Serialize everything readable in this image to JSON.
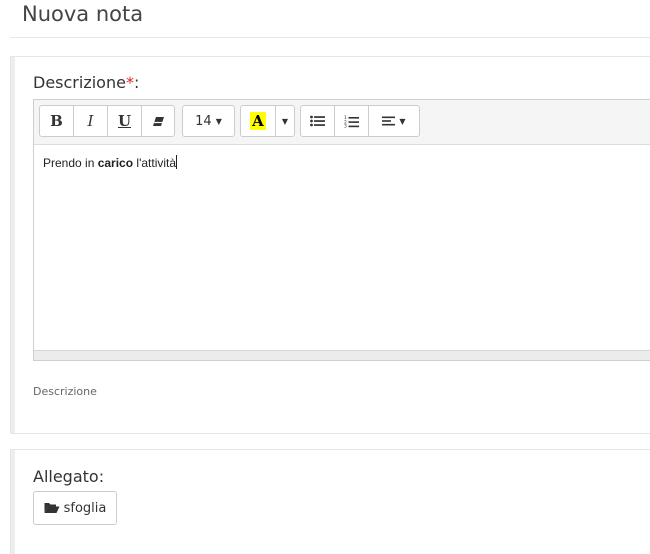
{
  "page": {
    "title": "Nuova nota"
  },
  "description": {
    "label": "Descrizione",
    "required_mark": "*",
    "label_suffix": ":",
    "help_text": "Descrizione",
    "editor": {
      "toolbar": {
        "bold_label": "B",
        "italic_label": "I",
        "underline_label": "U",
        "clear_format_icon": "eraser-icon",
        "font_size": "14",
        "highlight_label": "A",
        "highlight_color": "#ffff00",
        "unordered_list_icon": "list-ul-icon",
        "ordered_list_icon": "list-ol-icon",
        "align_icon": "align-left-icon"
      },
      "content": {
        "text_before": "Prendo in ",
        "text_bold": "carico",
        "text_after": " l'attività"
      }
    }
  },
  "attachment": {
    "label": "Allegato:",
    "browse_label": "sfoglia",
    "browse_icon": "folder-open-icon"
  },
  "colors": {
    "required": "#d9232d",
    "highlight": "#ffff00"
  }
}
